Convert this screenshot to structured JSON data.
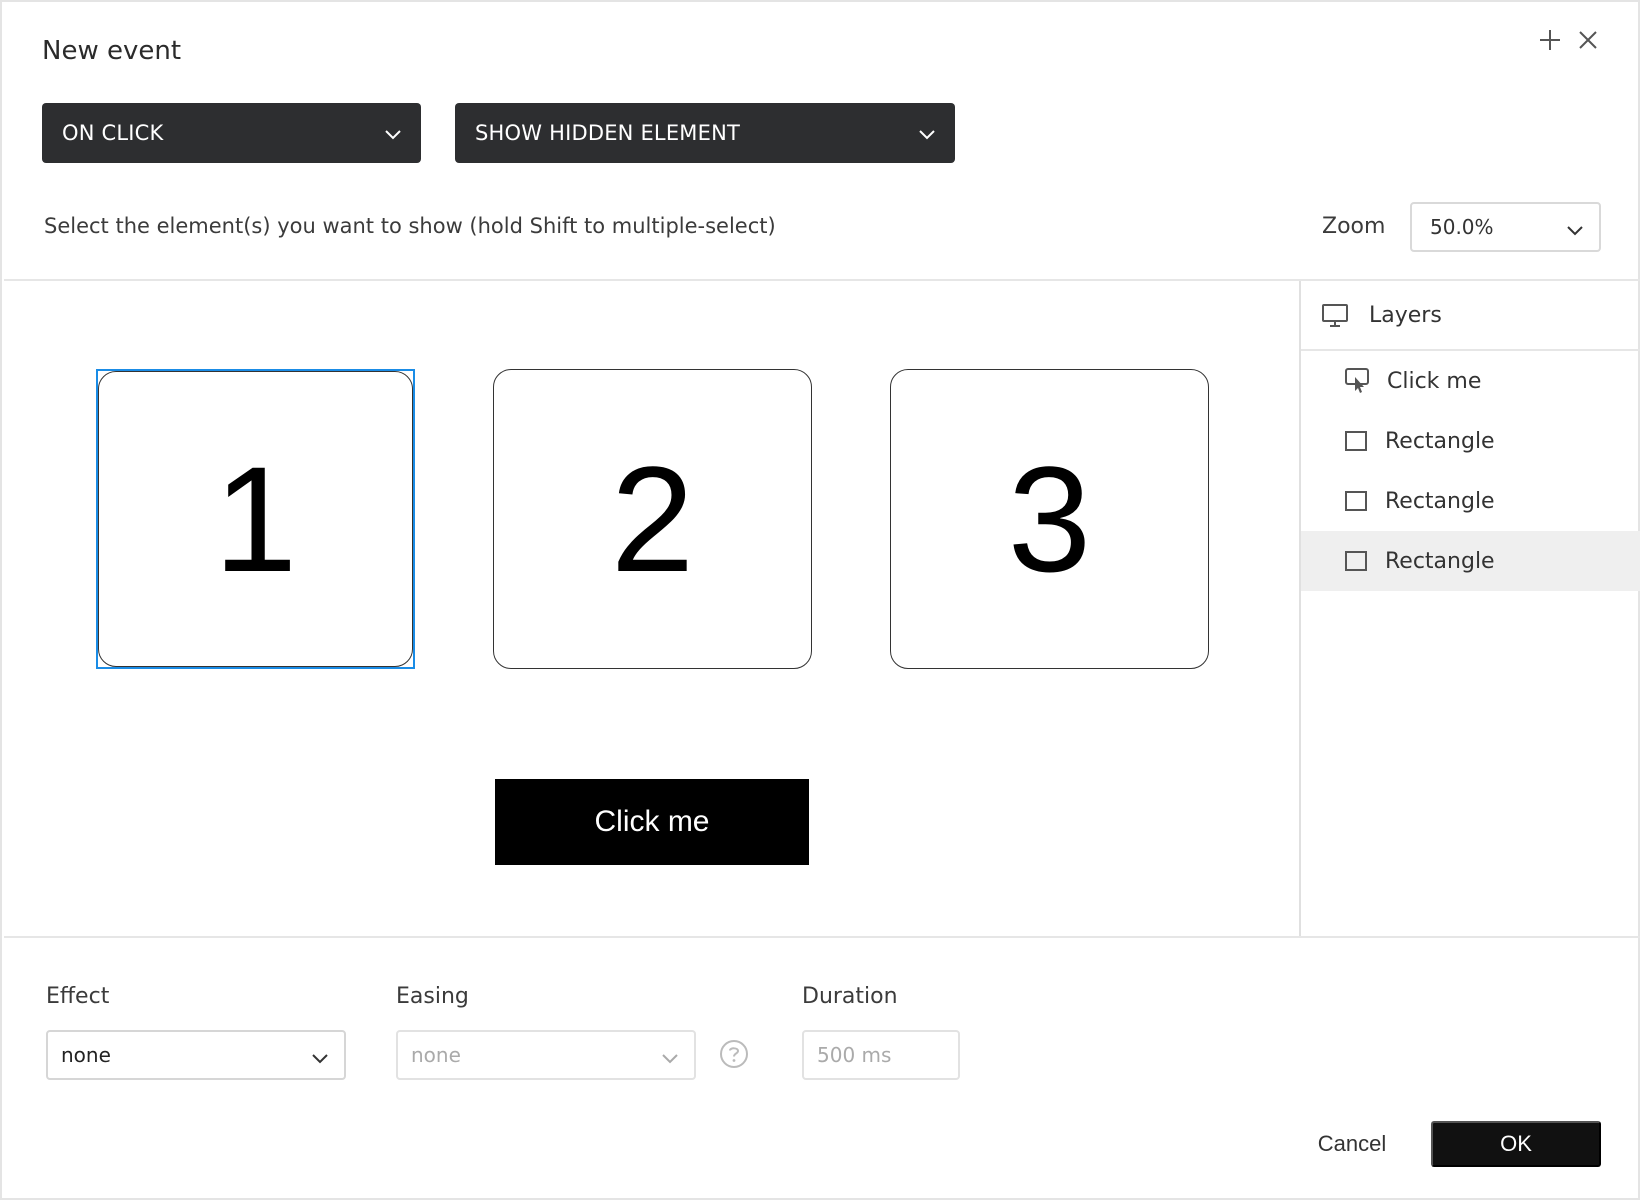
{
  "dialog": {
    "title": "New event"
  },
  "trigger": {
    "selected": "ON CLICK"
  },
  "action": {
    "selected": "SHOW HIDDEN ELEMENT"
  },
  "instruction": "Select the element(s) you want to show (hold Shift to multiple-select)",
  "zoom": {
    "label": "Zoom",
    "value": "50.0%"
  },
  "canvas": {
    "rectangles": [
      {
        "label": "1",
        "selected": true
      },
      {
        "label": "2",
        "selected": false
      },
      {
        "label": "3",
        "selected": false
      }
    ],
    "button_label": "Click me"
  },
  "layers": {
    "title": "Layers",
    "items": [
      {
        "label": "Click me",
        "icon": "button-layer-icon",
        "highlighted": false
      },
      {
        "label": "Rectangle",
        "icon": "rectangle-layer-icon",
        "highlighted": false
      },
      {
        "label": "Rectangle",
        "icon": "rectangle-layer-icon",
        "highlighted": false
      },
      {
        "label": "Rectangle",
        "icon": "rectangle-layer-icon",
        "highlighted": true
      }
    ]
  },
  "effect": {
    "label": "Effect",
    "value": "none"
  },
  "easing": {
    "label": "Easing",
    "value": "none"
  },
  "duration": {
    "label": "Duration",
    "placeholder": "500 ms"
  },
  "footer": {
    "cancel_label": "Cancel",
    "ok_label": "OK"
  },
  "colors": {
    "selection_blue": "#1a8ce6",
    "dark_dropdown": "#2d2e30",
    "ok_button": "#111111"
  }
}
